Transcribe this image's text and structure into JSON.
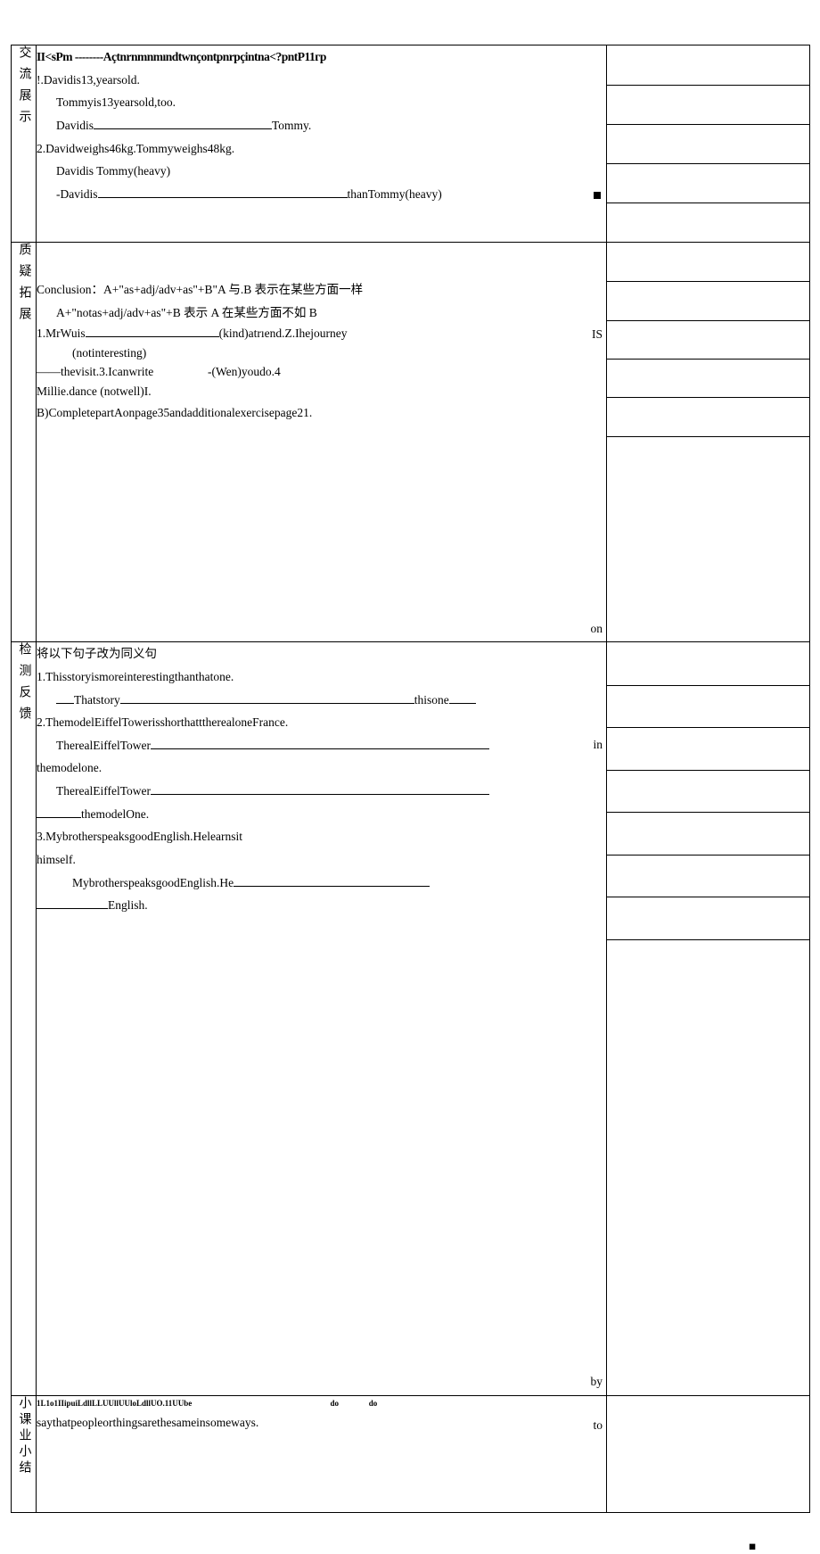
{
  "rows": [
    {
      "label": "交流展示",
      "side_cells": 5,
      "floats": [],
      "content": [
        {
          "cls": "garble bold",
          "text": "II<sPm --------Açtnrnmnmındtwnçontpnrpçintna<?pntP11гр"
        },
        {
          "cls": "",
          "text": "!.Davidis13,yearsold."
        },
        {
          "cls": "indent1",
          "text": "Tommyis13yearsold,too."
        },
        {
          "cls": "indent1",
          "html": "Davidis<span class='blank blank-long'></span>Tommy."
        },
        {
          "cls": "",
          "text": "2.Davidweighs46kg.Tommyweighs48kg."
        },
        {
          "cls": "indent1",
          "text": "Davidis                                       Tommy(heavy)"
        },
        {
          "cls": "indent1",
          "html": "-Davidis<span class='blank' style='width:280px'></span>thanTommy(heavy)<span style='float:right;margin-right:6px'><span class='sq'></span></span>"
        }
      ],
      "dashed": true
    },
    {
      "label": "质疑拓展",
      "side_cells": 6,
      "floats": [
        "IS",
        "",
        "on"
      ],
      "pre_gap": true,
      "content": [
        {
          "cls": "",
          "text": "Conclusion：A+\"as+adj/adv+as\"+B\"A 与.B 表示在某些方面一样"
        },
        {
          "cls": "indent1",
          "text": "A+\"notas+adj/adv+as\"+B 表示 A 在某些方面不如 B"
        },
        {
          "cls": "tight",
          "html": "1.MrWuis<span class='blank blank-med'></span>(kind)atrıend.Z.Ihejourney"
        },
        {
          "cls": "indent2 tight",
          "text": "(notinteresting)"
        },
        {
          "cls": "tight",
          "html": "——thevisit.3.Icanwrite&nbsp;&nbsp;&nbsp;&nbsp;&nbsp;&nbsp;&nbsp;&nbsp;&nbsp;&nbsp;&nbsp;&nbsp;&nbsp;&nbsp;&nbsp;&nbsp;&nbsp;&nbsp;-(Wen)youdo.4"
        },
        {
          "cls": "tight",
          "text": "Millie.dance          (notwell)I."
        },
        {
          "cls": "",
          "text": "B)CompletepartAonpage35andadditionalexercisepage21."
        }
      ]
    },
    {
      "label": "检测反馈",
      "side_cells": 8,
      "floats": [
        "",
        "in",
        "",
        "",
        "",
        "by"
      ],
      "content": [
        {
          "cls": "",
          "text": "将以下句子改为同义句"
        },
        {
          "cls": "",
          "text": "1.Thisstoryismoreinterestingthanthatone."
        },
        {
          "cls": "indent1",
          "html": "<span class='blank' style='width:20px'></span>Thatstory<span class='blank blank-vlong'></span>thisone<span class='blank' style='width:30px'></span>"
        },
        {
          "cls": "",
          "text": "2.ThemodelEiffelTowerisshorthatttherealoneFrance."
        },
        {
          "cls": "indent1",
          "html": "TherealEiffelTower<span class='blank' style='width:380px'></span>"
        },
        {
          "cls": "",
          "text": "themodelone."
        },
        {
          "cls": "indent1",
          "html": "TherealEiffelTower<span class='blank' style='width:380px'></span>"
        },
        {
          "cls": "",
          "html": "<span class='blank' style='width:50px'></span>themodelOne."
        },
        {
          "cls": "",
          "text": "3.MybrotherspeaksgoodEnglish.Helearnsit"
        },
        {
          "cls": "",
          "text": "himself."
        },
        {
          "cls": "indent2",
          "html": "MybrotherspeaksgoodEnglish.He<span class='blank' style='width:220px'></span>"
        },
        {
          "cls": "",
          "html": "<span class='blank blank-short'></span>English."
        }
      ]
    },
    {
      "label": "小课业小结",
      "side_cells": 1,
      "floats": [
        "to"
      ],
      "content": [
        {
          "cls": "tiny-garble",
          "html": "1L1o1IIipuiLdllLLUUllUUloLdllUO.11UUbe&nbsp;&nbsp;&nbsp;&nbsp;&nbsp;&nbsp;&nbsp;&nbsp;&nbsp;&nbsp;&nbsp;&nbsp;&nbsp;&nbsp;&nbsp;&nbsp;&nbsp;&nbsp;&nbsp;&nbsp;&nbsp;&nbsp;&nbsp;&nbsp;&nbsp;&nbsp;&nbsp;&nbsp;&nbsp;&nbsp;&nbsp;&nbsp;&nbsp;&nbsp;&nbsp;&nbsp;&nbsp;&nbsp;&nbsp;&nbsp;&nbsp;&nbsp;&nbsp;&nbsp;&nbsp;&nbsp;&nbsp;&nbsp;&nbsp;&nbsp;&nbsp;&nbsp;&nbsp;&nbsp;&nbsp;&nbsp;&nbsp;&nbsp;&nbsp;&nbsp;&nbsp;&nbsp;&nbsp;&nbsp;&nbsp;&nbsp;&nbsp;&nbsp;&nbsp;do&nbsp;&nbsp;&nbsp;&nbsp;&nbsp;&nbsp;&nbsp;&nbsp;&nbsp;&nbsp;&nbsp;&nbsp;&nbsp;&nbsp;&nbsp;do"
        },
        {
          "cls": "",
          "text": "saythatpeopleorthingsarethesameinsomeways."
        }
      ],
      "label_tight": true
    }
  ],
  "footer_square": "■"
}
